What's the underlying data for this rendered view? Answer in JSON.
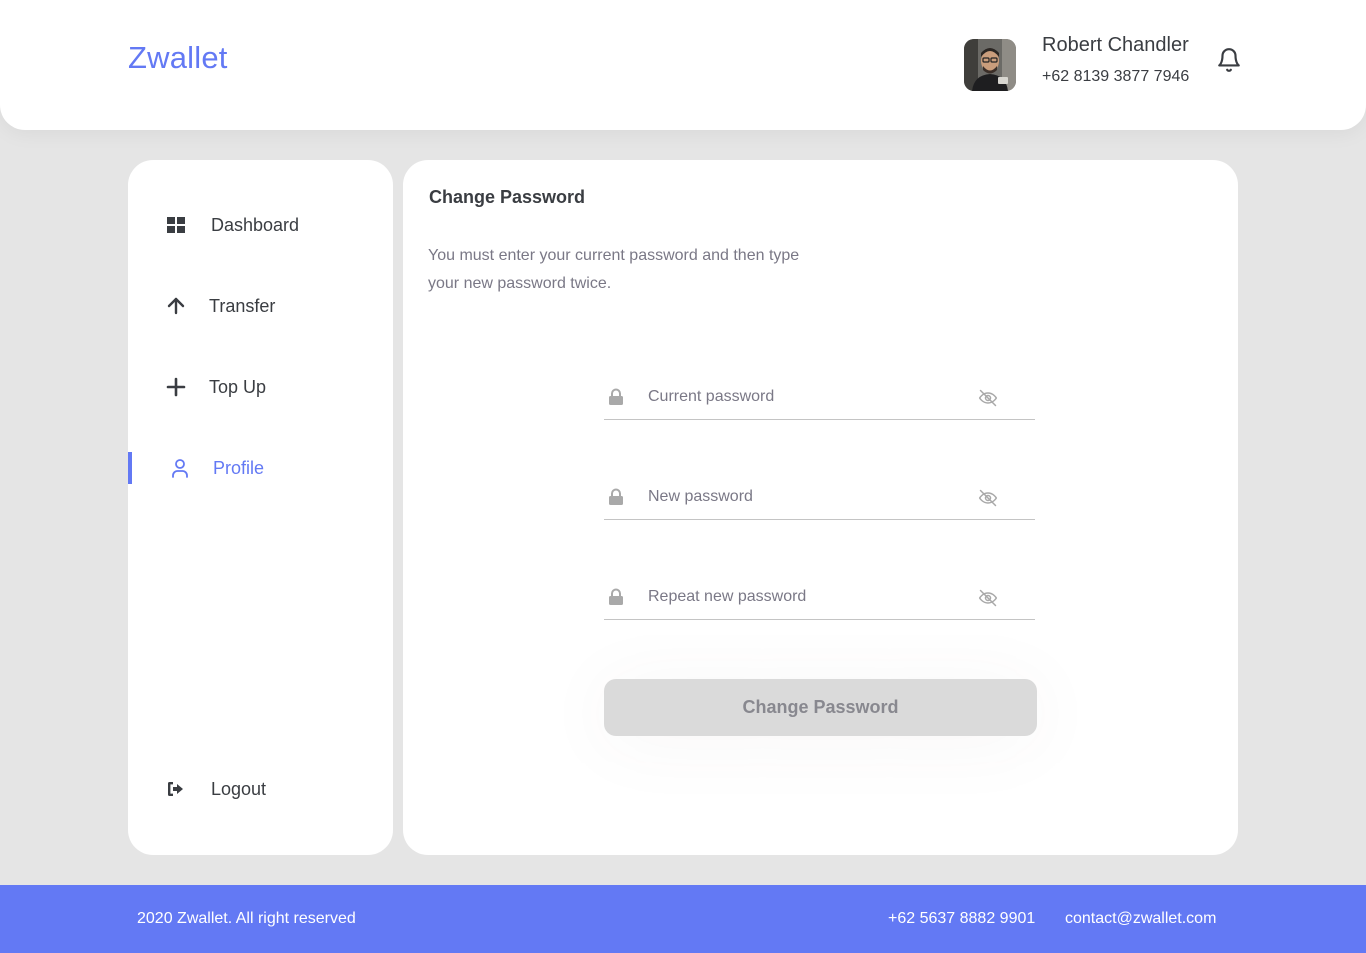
{
  "header": {
    "brand": "Zwallet",
    "user": {
      "name": "Robert Chandler",
      "phone": "+62 8139 3877 7946",
      "avatar_icon": "user-photo"
    },
    "notification_icon": "bell-icon"
  },
  "sidebar": {
    "items": [
      {
        "label": "Dashboard",
        "icon": "grid-icon",
        "active": false
      },
      {
        "label": "Transfer",
        "icon": "arrow-up-icon",
        "active": false
      },
      {
        "label": "Top Up",
        "icon": "plus-icon",
        "active": false
      },
      {
        "label": "Profile",
        "icon": "user-icon",
        "active": true
      }
    ],
    "logout": {
      "label": "Logout",
      "icon": "logout-icon"
    }
  },
  "main": {
    "title": "Change Password",
    "description": "You must enter your current password and then type your new password twice.",
    "fields": [
      {
        "placeholder": "Current password",
        "value": ""
      },
      {
        "placeholder": "New password",
        "value": ""
      },
      {
        "placeholder": "Repeat new password",
        "value": ""
      }
    ],
    "submit_label": "Change Password"
  },
  "footer": {
    "copyright": "2020 Zwallet. All right reserved",
    "phone": "+62 5637 8882 9901",
    "email": "contact@zwallet.com"
  },
  "colors": {
    "primary": "#6379F4",
    "background": "#E5E5E5",
    "text": "#3A3D42",
    "muted": "#7A7886",
    "button_disabled": "#DADADA"
  }
}
